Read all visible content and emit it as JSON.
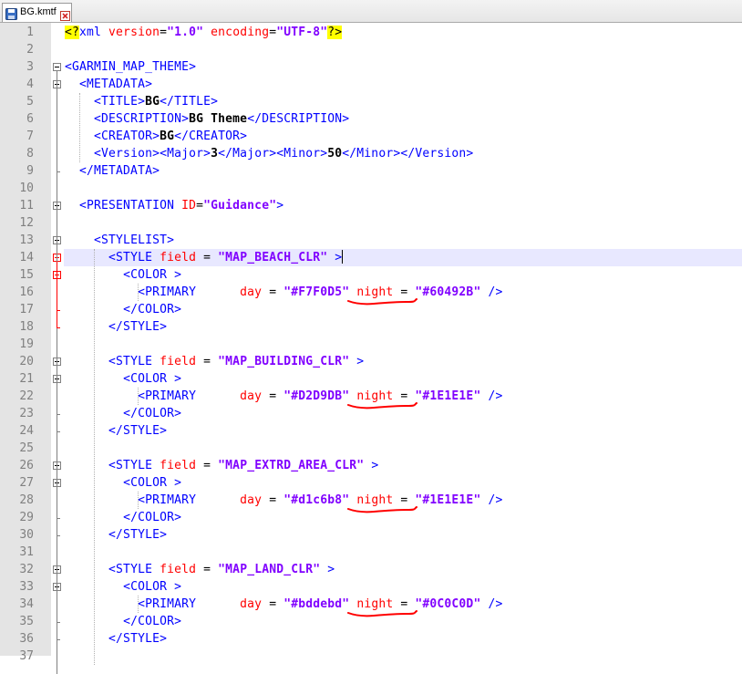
{
  "tab": {
    "filename": "BG.kmtf"
  },
  "editor": {
    "current_line": 14,
    "lines": [
      {
        "n": "1",
        "tokens": [
          {
            "t": "<?",
            "c": "t-decl"
          },
          {
            "t": "xml ",
            "c": "t-tag"
          },
          {
            "t": "version",
            "c": "t-attr"
          },
          {
            "t": "=",
            "c": ""
          },
          {
            "t": "\"1.0\"",
            "c": "t-val"
          },
          {
            "t": " ",
            "c": ""
          },
          {
            "t": "encoding",
            "c": "t-attr"
          },
          {
            "t": "=",
            "c": ""
          },
          {
            "t": "\"UTF-8\"",
            "c": "t-val"
          },
          {
            "t": "?>",
            "c": "t-decl"
          }
        ]
      },
      {
        "n": "2",
        "tokens": []
      },
      {
        "n": "3",
        "tokens": [
          {
            "t": "<GARMIN_MAP_THEME>",
            "c": "t-tag"
          }
        ]
      },
      {
        "n": "4",
        "tokens": [
          {
            "t": "  ",
            "c": ""
          },
          {
            "t": "<METADATA>",
            "c": "t-tag"
          }
        ]
      },
      {
        "n": "5",
        "tokens": [
          {
            "t": "    ",
            "c": ""
          },
          {
            "t": "<TITLE>",
            "c": "t-tag"
          },
          {
            "t": "BG",
            "c": "t-bold"
          },
          {
            "t": "</TITLE>",
            "c": "t-tag"
          }
        ]
      },
      {
        "n": "6",
        "tokens": [
          {
            "t": "    ",
            "c": ""
          },
          {
            "t": "<DESCRIPTION>",
            "c": "t-tag"
          },
          {
            "t": "BG Theme",
            "c": "t-bold"
          },
          {
            "t": "</DESCRIPTION>",
            "c": "t-tag"
          }
        ]
      },
      {
        "n": "7",
        "tokens": [
          {
            "t": "    ",
            "c": ""
          },
          {
            "t": "<CREATOR>",
            "c": "t-tag"
          },
          {
            "t": "BG",
            "c": "t-bold"
          },
          {
            "t": "</CREATOR>",
            "c": "t-tag"
          }
        ]
      },
      {
        "n": "8",
        "tokens": [
          {
            "t": "    ",
            "c": ""
          },
          {
            "t": "<Version><Major>",
            "c": "t-tag"
          },
          {
            "t": "3",
            "c": "t-bold"
          },
          {
            "t": "</Major><Minor>",
            "c": "t-tag"
          },
          {
            "t": "50",
            "c": "t-bold"
          },
          {
            "t": "</Minor></Version>",
            "c": "t-tag"
          }
        ]
      },
      {
        "n": "9",
        "tokens": [
          {
            "t": "  ",
            "c": ""
          },
          {
            "t": "</METADATA>",
            "c": "t-tag"
          }
        ]
      },
      {
        "n": "10",
        "tokens": []
      },
      {
        "n": "11",
        "tokens": [
          {
            "t": "  ",
            "c": ""
          },
          {
            "t": "<PRESENTATION ",
            "c": "t-tag"
          },
          {
            "t": "ID",
            "c": "t-attr"
          },
          {
            "t": "=",
            "c": ""
          },
          {
            "t": "\"Guidance\"",
            "c": "t-val"
          },
          {
            "t": ">",
            "c": "t-tag"
          }
        ]
      },
      {
        "n": "12",
        "tokens": []
      },
      {
        "n": "13",
        "tokens": [
          {
            "t": "    ",
            "c": ""
          },
          {
            "t": "<STYLELIST>",
            "c": "t-tag"
          }
        ]
      },
      {
        "n": "14",
        "tokens": [
          {
            "t": "      ",
            "c": ""
          },
          {
            "t": "<STYLE ",
            "c": "t-tag"
          },
          {
            "t": "field",
            "c": "t-attr"
          },
          {
            "t": " = ",
            "c": ""
          },
          {
            "t": "\"MAP_BEACH_CLR\"",
            "c": "t-val"
          },
          {
            "t": " >",
            "c": "t-tag"
          }
        ]
      },
      {
        "n": "15",
        "tokens": [
          {
            "t": "        ",
            "c": ""
          },
          {
            "t": "<COLOR >",
            "c": "t-tag"
          }
        ]
      },
      {
        "n": "16",
        "tokens": [
          {
            "t": "          ",
            "c": ""
          },
          {
            "t": "<PRIMARY      ",
            "c": "t-tag"
          },
          {
            "t": "day",
            "c": "t-attr"
          },
          {
            "t": " = ",
            "c": ""
          },
          {
            "t": "\"#F7F0D5\"",
            "c": "t-val"
          },
          {
            "t": " ",
            "c": ""
          },
          {
            "t": "night",
            "c": "t-attr"
          },
          {
            "t": " = ",
            "c": ""
          },
          {
            "t": "\"#60492B\"",
            "c": "t-val"
          },
          {
            "t": " />",
            "c": "t-tag"
          }
        ]
      },
      {
        "n": "17",
        "tokens": [
          {
            "t": "        ",
            "c": ""
          },
          {
            "t": "</COLOR>",
            "c": "t-tag"
          }
        ]
      },
      {
        "n": "18",
        "tokens": [
          {
            "t": "      ",
            "c": ""
          },
          {
            "t": "</STYLE>",
            "c": "t-tag"
          }
        ]
      },
      {
        "n": "19",
        "tokens": []
      },
      {
        "n": "20",
        "tokens": [
          {
            "t": "      ",
            "c": ""
          },
          {
            "t": "<STYLE ",
            "c": "t-tag"
          },
          {
            "t": "field",
            "c": "t-attr"
          },
          {
            "t": " = ",
            "c": ""
          },
          {
            "t": "\"MAP_BUILDING_CLR\"",
            "c": "t-val"
          },
          {
            "t": " >",
            "c": "t-tag"
          }
        ]
      },
      {
        "n": "21",
        "tokens": [
          {
            "t": "        ",
            "c": ""
          },
          {
            "t": "<COLOR >",
            "c": "t-tag"
          }
        ]
      },
      {
        "n": "22",
        "tokens": [
          {
            "t": "          ",
            "c": ""
          },
          {
            "t": "<PRIMARY      ",
            "c": "t-tag"
          },
          {
            "t": "day",
            "c": "t-attr"
          },
          {
            "t": " = ",
            "c": ""
          },
          {
            "t": "\"#D2D9DB\"",
            "c": "t-val"
          },
          {
            "t": " ",
            "c": ""
          },
          {
            "t": "night",
            "c": "t-attr"
          },
          {
            "t": " = ",
            "c": ""
          },
          {
            "t": "\"#1E1E1E\"",
            "c": "t-val"
          },
          {
            "t": " />",
            "c": "t-tag"
          }
        ]
      },
      {
        "n": "23",
        "tokens": [
          {
            "t": "        ",
            "c": ""
          },
          {
            "t": "</COLOR>",
            "c": "t-tag"
          }
        ]
      },
      {
        "n": "24",
        "tokens": [
          {
            "t": "      ",
            "c": ""
          },
          {
            "t": "</STYLE>",
            "c": "t-tag"
          }
        ]
      },
      {
        "n": "25",
        "tokens": []
      },
      {
        "n": "26",
        "tokens": [
          {
            "t": "      ",
            "c": ""
          },
          {
            "t": "<STYLE ",
            "c": "t-tag"
          },
          {
            "t": "field",
            "c": "t-attr"
          },
          {
            "t": " = ",
            "c": ""
          },
          {
            "t": "\"MAP_EXTRD_AREA_CLR\"",
            "c": "t-val"
          },
          {
            "t": " >",
            "c": "t-tag"
          }
        ]
      },
      {
        "n": "27",
        "tokens": [
          {
            "t": "        ",
            "c": ""
          },
          {
            "t": "<COLOR >",
            "c": "t-tag"
          }
        ]
      },
      {
        "n": "28",
        "tokens": [
          {
            "t": "          ",
            "c": ""
          },
          {
            "t": "<PRIMARY      ",
            "c": "t-tag"
          },
          {
            "t": "day",
            "c": "t-attr"
          },
          {
            "t": " = ",
            "c": ""
          },
          {
            "t": "\"#d1c6b8\"",
            "c": "t-val"
          },
          {
            "t": " ",
            "c": ""
          },
          {
            "t": "night",
            "c": "t-attr"
          },
          {
            "t": " = ",
            "c": ""
          },
          {
            "t": "\"#1E1E1E\"",
            "c": "t-val"
          },
          {
            "t": " />",
            "c": "t-tag"
          }
        ]
      },
      {
        "n": "29",
        "tokens": [
          {
            "t": "        ",
            "c": ""
          },
          {
            "t": "</COLOR>",
            "c": "t-tag"
          }
        ]
      },
      {
        "n": "30",
        "tokens": [
          {
            "t": "      ",
            "c": ""
          },
          {
            "t": "</STYLE>",
            "c": "t-tag"
          }
        ]
      },
      {
        "n": "31",
        "tokens": []
      },
      {
        "n": "32",
        "tokens": [
          {
            "t": "      ",
            "c": ""
          },
          {
            "t": "<STYLE ",
            "c": "t-tag"
          },
          {
            "t": "field",
            "c": "t-attr"
          },
          {
            "t": " = ",
            "c": ""
          },
          {
            "t": "\"MAP_LAND_CLR\"",
            "c": "t-val"
          },
          {
            "t": " >",
            "c": "t-tag"
          }
        ]
      },
      {
        "n": "33",
        "tokens": [
          {
            "t": "        ",
            "c": ""
          },
          {
            "t": "<COLOR >",
            "c": "t-tag"
          }
        ]
      },
      {
        "n": "34",
        "tokens": [
          {
            "t": "          ",
            "c": ""
          },
          {
            "t": "<PRIMARY      ",
            "c": "t-tag"
          },
          {
            "t": "day",
            "c": "t-attr"
          },
          {
            "t": " = ",
            "c": ""
          },
          {
            "t": "\"#bddebd\"",
            "c": "t-val"
          },
          {
            "t": " ",
            "c": ""
          },
          {
            "t": "night",
            "c": "t-attr"
          },
          {
            "t": " = ",
            "c": ""
          },
          {
            "t": "\"#0C0C0D\"",
            "c": "t-val"
          },
          {
            "t": " />",
            "c": "t-tag"
          }
        ]
      },
      {
        "n": "35",
        "tokens": [
          {
            "t": "        ",
            "c": ""
          },
          {
            "t": "</COLOR>",
            "c": "t-tag"
          }
        ]
      },
      {
        "n": "36",
        "tokens": [
          {
            "t": "      ",
            "c": ""
          },
          {
            "t": "</STYLE>",
            "c": "t-tag"
          }
        ]
      },
      {
        "n": "37",
        "tokens": []
      }
    ]
  },
  "colors": {
    "tag": "#0000ff",
    "attribute": "#ff0000",
    "value": "#8000ff",
    "current_line_bg": "#e8e8ff",
    "declaration_highlight": "#ffff00",
    "annotation_underline": "#ff0000"
  },
  "icons": {
    "tab_save": "save-icon",
    "tab_close": "close-icon"
  }
}
